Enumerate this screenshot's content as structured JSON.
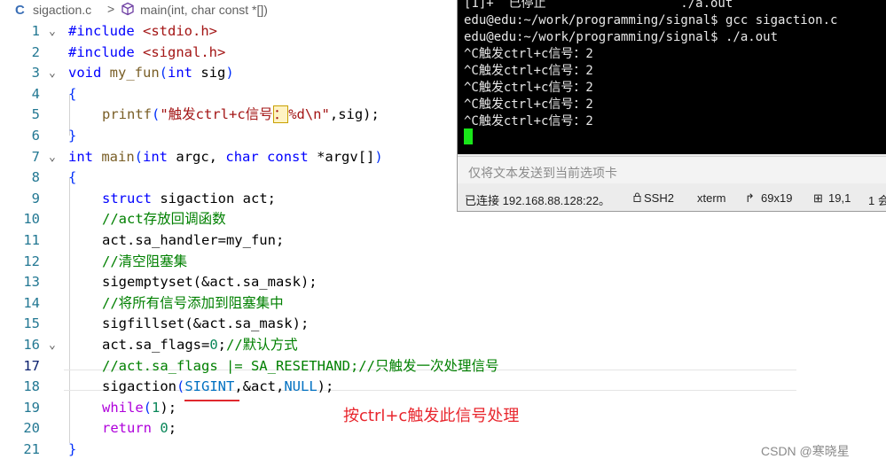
{
  "breadcrumb": {
    "file_icon": "C",
    "file_name": "sigaction.c",
    "separator": ">",
    "symbol_icon": "cube-icon",
    "symbol": "main(int, char const *[])"
  },
  "editor": {
    "line_numbers": [
      "1",
      "2",
      "3",
      "4",
      "5",
      "6",
      "7",
      "8",
      "9",
      "10",
      "11",
      "12",
      "13",
      "14",
      "15",
      "16",
      "17",
      "18",
      "19",
      "20",
      "21"
    ],
    "line1": {
      "directive": "#include",
      "header": "<stdio.h>"
    },
    "line2": {
      "directive": "#include",
      "header": "<signal.h>"
    },
    "line3": {
      "type": "void",
      "name": "my_fun",
      "open": "(",
      "ptype": "int",
      "param": "sig",
      "close": ")"
    },
    "line4": "{",
    "line5": {
      "func": "printf",
      "open": "(",
      "str_a": "\"触发ctrl+c信号",
      "str_colon": "：",
      "str_b": "%d\\n\"",
      "rest": ",sig);"
    },
    "line6": "}",
    "line7": {
      "type": "int",
      "name": "main",
      "open": "(",
      "p1type": "int",
      "p1": "argc,",
      "p2type": "char",
      "p2const": "const",
      "p2": "*argv[]",
      "close": ")"
    },
    "line8": "{",
    "line9": {
      "kw": "struct",
      "rest": "sigaction act;"
    },
    "line10": "//act存放回调函数",
    "line11": "act.sa_handler=my_fun;",
    "line12": "//清空阻塞集",
    "line13": {
      "func": "sigemptyset",
      "args": "(&act.sa_mask);"
    },
    "line14": "//将所有信号添加到阻塞集中",
    "line15": {
      "func": "sigfillset",
      "args": "(&act.sa_mask);"
    },
    "line16": {
      "code": "act.sa_flags=",
      "num": "0",
      "semi": ";",
      "comment": "//默认方式"
    },
    "line17": "//act.sa_flags |= SA_RESETHAND;//只触发一次处理信号",
    "line18": {
      "func": "sigaction",
      "open": "(",
      "macro1": "SIGINT",
      "mid": ",&act,",
      "macro2": "NULL",
      "end": ");"
    },
    "line19": {
      "kw": "while",
      "open": "(",
      "num": "1",
      "end": ");"
    },
    "line20": {
      "kw": "return",
      "num": "0",
      "end": ";"
    },
    "line21": "}"
  },
  "annotation": "按ctrl+c触发此信号处理",
  "watermark": "CSDN @寒晓星",
  "terminal": {
    "lines": [
      "[1]+  已停止                  ./a.out",
      "edu@edu:~/work/programming/signal$ gcc sigaction.c",
      "edu@edu:~/work/programming/signal$ ./a.out",
      "^C触发ctrl+c信号：2",
      "^C触发ctrl+c信号：2",
      "^C触发ctrl+c信号：2",
      "^C触发ctrl+c信号：2",
      "^C触发ctrl+c信号：2"
    ],
    "input_placeholder": "仅将文本发送到当前选项卡",
    "status": {
      "connection": "已连接 192.168.88.128:22。",
      "protocol": "SSH2",
      "terminal_type": "xterm",
      "size": "69x19",
      "position": "19,1",
      "sessions": "1 会"
    }
  },
  "colors": {
    "annotation": "#e8262d",
    "cursor": "#19e619",
    "line_number": "#237893"
  }
}
